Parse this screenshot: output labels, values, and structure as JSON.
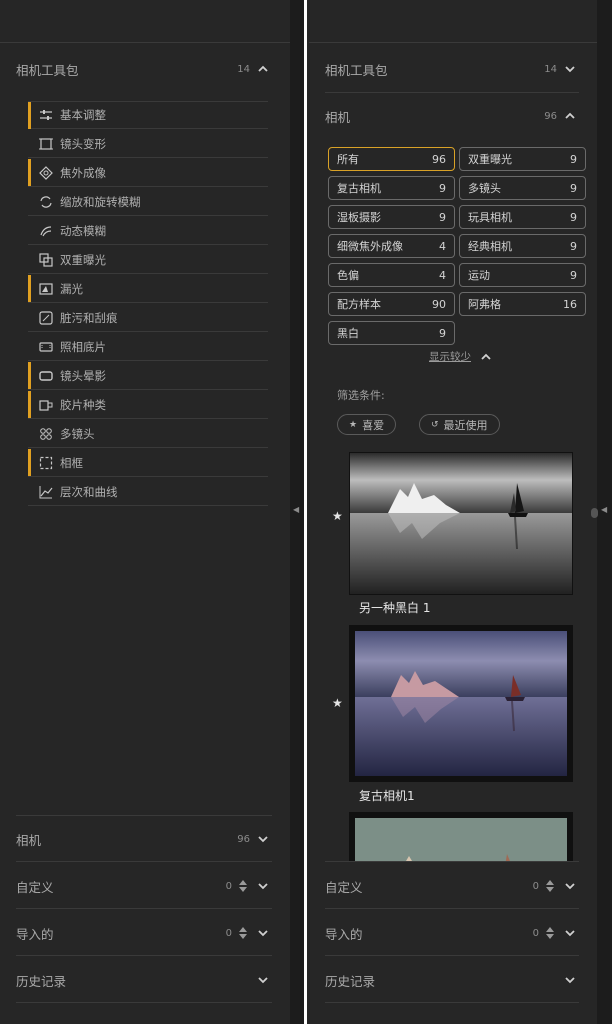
{
  "left": {
    "toolkit": {
      "title": "相机工具包",
      "count": "14"
    },
    "tools": [
      {
        "label": "基本调整",
        "icon": "sliders-icon",
        "marked": true
      },
      {
        "label": "镜头变形",
        "icon": "crop-frame-icon",
        "marked": false
      },
      {
        "label": "焦外成像",
        "icon": "focus-blur-icon",
        "marked": true
      },
      {
        "label": "缩放和旋转模糊",
        "icon": "rotate-arrows-icon",
        "marked": false
      },
      {
        "label": "动态模糊",
        "icon": "motion-blur-icon",
        "marked": false
      },
      {
        "label": "双重曝光",
        "icon": "double-exposure-icon",
        "marked": false
      },
      {
        "label": "漏光",
        "icon": "light-leak-icon",
        "marked": true
      },
      {
        "label": "脏污和刮痕",
        "icon": "dirt-scratch-icon",
        "marked": false
      },
      {
        "label": "照相底片",
        "icon": "film-negative-icon",
        "marked": false
      },
      {
        "label": "镜头晕影",
        "icon": "vignette-icon",
        "marked": true
      },
      {
        "label": "胶片种类",
        "icon": "film-type-icon",
        "marked": true
      },
      {
        "label": "多镜头",
        "icon": "multi-lens-icon",
        "marked": false
      },
      {
        "label": "相框",
        "icon": "frame-icon",
        "marked": true
      },
      {
        "label": "层次和曲线",
        "icon": "curves-icon",
        "marked": false
      }
    ],
    "camera": {
      "title": "相机",
      "count": "96"
    },
    "custom": {
      "title": "自定义",
      "count": "0"
    },
    "imported": {
      "title": "导入的",
      "count": "0"
    },
    "history": {
      "title": "历史记录"
    }
  },
  "right": {
    "toolkit": {
      "title": "相机工具包",
      "count": "14"
    },
    "camera": {
      "title": "相机",
      "count": "96"
    },
    "categories": [
      {
        "name": "所有",
        "count": "96",
        "selected": true
      },
      {
        "name": "双重曝光",
        "count": "9"
      },
      {
        "name": "复古相机",
        "count": "9"
      },
      {
        "name": "多镜头",
        "count": "9"
      },
      {
        "name": "湿板摄影",
        "count": "9"
      },
      {
        "name": "玩具相机",
        "count": "9"
      },
      {
        "name": "细微焦外成像",
        "count": "4"
      },
      {
        "name": "经典相机",
        "count": "9"
      },
      {
        "name": "色偏",
        "count": "4"
      },
      {
        "name": "运动",
        "count": "9"
      },
      {
        "name": "配方样本",
        "count": "90"
      },
      {
        "name": "阿弗格",
        "count": "16"
      },
      {
        "name": "黑白",
        "count": "9"
      }
    ],
    "show_less": "显示较少",
    "filter_label": "筛选条件:",
    "chip_favorite": "喜爱",
    "chip_recent": "最近使用",
    "presets": [
      {
        "label": "另一种黑白 1",
        "favorite": true
      },
      {
        "label": "复古相机1",
        "favorite": true
      }
    ],
    "custom": {
      "title": "自定义",
      "count": "0"
    },
    "imported": {
      "title": "导入的",
      "count": "0"
    },
    "history": {
      "title": "历史记录"
    }
  },
  "colors": {
    "accent": "#e0a021",
    "panel": "#262626",
    "divider": "#3a3a3a"
  }
}
